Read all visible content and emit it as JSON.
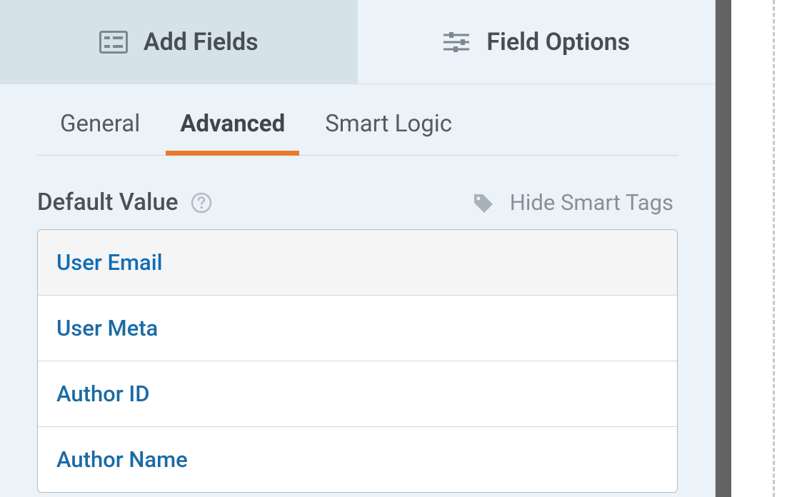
{
  "topTabs": {
    "addFields": "Add Fields",
    "fieldOptions": "Field Options"
  },
  "subTabs": {
    "general": "General",
    "advanced": "Advanced",
    "smartLogic": "Smart Logic"
  },
  "section": {
    "title": "Default Value",
    "hideSmartTags": "Hide Smart Tags"
  },
  "smartTags": [
    "User Email",
    "User Meta",
    "Author ID",
    "Author Name"
  ]
}
